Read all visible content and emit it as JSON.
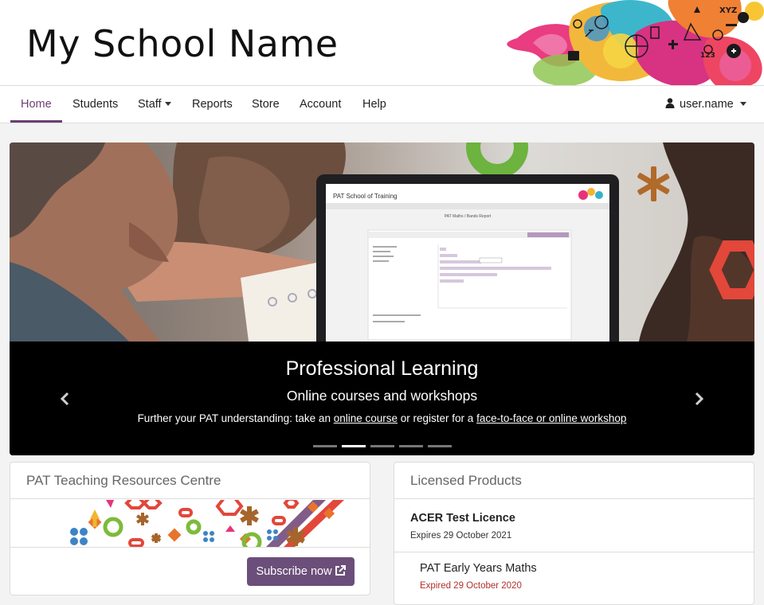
{
  "header": {
    "school_name": "My School Name",
    "art_text_xyz": "XYZ",
    "art_text_123": "123"
  },
  "nav": {
    "items": [
      {
        "label": "Home",
        "active": true
      },
      {
        "label": "Students"
      },
      {
        "label": "Staff",
        "dropdown": true
      },
      {
        "label": "Reports"
      },
      {
        "label": "Store"
      },
      {
        "label": "Account"
      },
      {
        "label": "Help"
      }
    ],
    "user": {
      "label": "user.name",
      "icon": "user-icon"
    }
  },
  "carousel": {
    "screen": {
      "title": "PAT School of Training",
      "report_title": "PAT Maths / Bands Report"
    },
    "title": "Professional Learning",
    "subtitle": "Online courses and workshops",
    "text_before": "Further your PAT understanding: take an ",
    "link1": "online course",
    "text_middle": " or register for a ",
    "link2": "face-to-face or online workshop",
    "slide_count": 5,
    "active_slide": 2,
    "prev_icon": "chevron-left-icon",
    "next_icon": "chevron-right-icon"
  },
  "resources": {
    "heading": "PAT Teaching Resources Centre",
    "button_label": "Subscribe now",
    "button_icon": "external-link-icon"
  },
  "licensed": {
    "heading": "Licensed Products",
    "licence_name": "ACER Test Licence",
    "licence_expiry": "Expires 29 October 2021",
    "product_name": "PAT Early Years Maths",
    "product_expiry": "Expired 29 October 2020"
  },
  "colors": {
    "accent": "#6b3f73",
    "button": "#6b4e79",
    "expired": "#b0302c",
    "orange": "#e8742c",
    "green": "#7dbb3b",
    "red": "#e2473a",
    "blue": "#3e84c5",
    "brown": "#a6652a"
  }
}
